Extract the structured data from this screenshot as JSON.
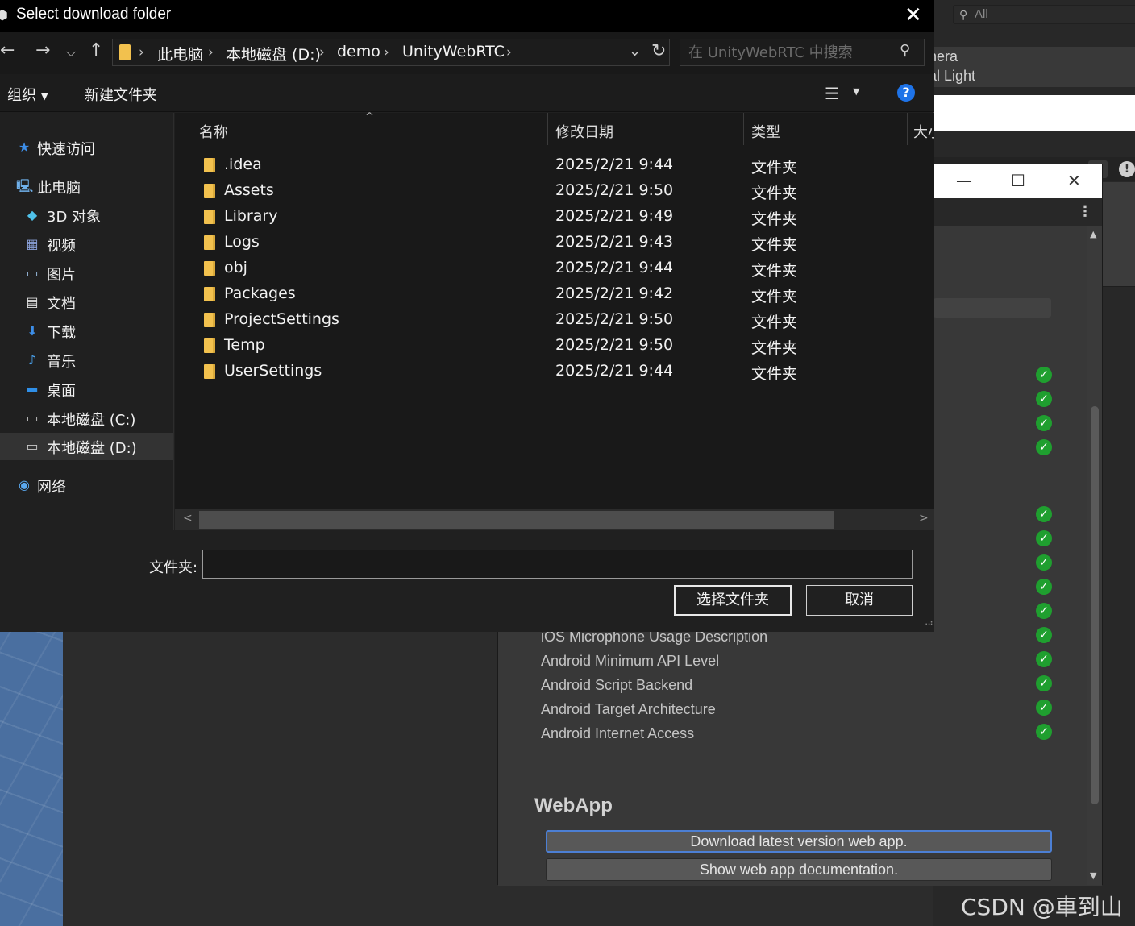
{
  "unity": {
    "search_placeholder": "All",
    "hierarchy_items": [
      "nera",
      "al Light"
    ],
    "settings_labels": [
      "iOS Microphone Usage Description",
      "Android Minimum API Level",
      "Android Script Backend",
      "Android Target Architecture",
      "Android Internet Access"
    ],
    "webapp_title": "WebApp",
    "download_button": "Download latest version web app.",
    "docs_button": "Show web app documentation.",
    "watermark": "CSDN @車到山前"
  },
  "dialog": {
    "title": "Select download folder",
    "breadcrumb": [
      "此电脑",
      "本地磁盘 (D:)",
      "demo",
      "UnityWebRTC"
    ],
    "search_placeholder": "在 UnityWebRTC 中搜索",
    "toolbar": {
      "organize": "组织",
      "new_folder": "新建文件夹"
    },
    "nav": {
      "quick_access": "快速访问",
      "this_pc": "此电脑",
      "items": [
        "3D 对象",
        "视频",
        "图片",
        "文档",
        "下载",
        "音乐",
        "桌面",
        "本地磁盘 (C:)",
        "本地磁盘 (D:)"
      ],
      "network": "网络"
    },
    "columns": {
      "name": "名称",
      "date": "修改日期",
      "type": "类型",
      "size": "大小"
    },
    "files": [
      {
        "name": ".idea",
        "date": "2025/2/21 9:44",
        "type": "文件夹"
      },
      {
        "name": "Assets",
        "date": "2025/2/21 9:50",
        "type": "文件夹"
      },
      {
        "name": "Library",
        "date": "2025/2/21 9:49",
        "type": "文件夹"
      },
      {
        "name": "Logs",
        "date": "2025/2/21 9:43",
        "type": "文件夹"
      },
      {
        "name": "obj",
        "date": "2025/2/21 9:44",
        "type": "文件夹"
      },
      {
        "name": "Packages",
        "date": "2025/2/21 9:42",
        "type": "文件夹"
      },
      {
        "name": "ProjectSettings",
        "date": "2025/2/21 9:50",
        "type": "文件夹"
      },
      {
        "name": "Temp",
        "date": "2025/2/21 9:50",
        "type": "文件夹"
      },
      {
        "name": "UserSettings",
        "date": "2025/2/21 9:44",
        "type": "文件夹"
      }
    ],
    "folder_label": "文件夹:",
    "folder_value": "",
    "select_button": "选择文件夹",
    "cancel_button": "取消"
  }
}
